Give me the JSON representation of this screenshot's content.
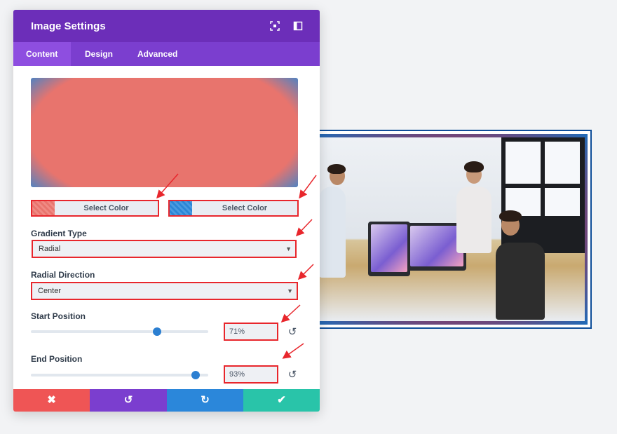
{
  "modal": {
    "title": "Image Settings",
    "header_icons": [
      "focus-icon",
      "sidebar-layout-icon"
    ]
  },
  "tabs": [
    {
      "label": "Content",
      "active": true
    },
    {
      "label": "Design",
      "active": false
    },
    {
      "label": "Advanced",
      "active": false
    }
  ],
  "gradient": {
    "color1": "#e8746d",
    "color2": "#2b86d6",
    "select_color_1": "Select Color",
    "select_color_2": "Select Color",
    "gradient_type_label": "Gradient Type",
    "gradient_type_value": "Radial",
    "radial_direction_label": "Radial Direction",
    "radial_direction_value": "Center",
    "start_position_label": "Start Position",
    "start_position_value": "71%",
    "start_position_fraction": 0.71,
    "end_position_label": "End Position",
    "end_position_value": "93%",
    "end_position_fraction": 0.93
  },
  "footer": {
    "buttons": [
      {
        "name": "cancel",
        "icon": "close-icon",
        "glyph": "✖",
        "color": "#ef5555"
      },
      {
        "name": "undo",
        "icon": "undo-icon",
        "glyph": "↺",
        "color": "#7b3ecf"
      },
      {
        "name": "redo",
        "icon": "redo-icon",
        "glyph": "↻",
        "color": "#2b87da"
      },
      {
        "name": "save",
        "icon": "check-icon",
        "glyph": "✔",
        "color": "#29c4a9"
      }
    ]
  },
  "colors": {
    "header": "#6c2eb9",
    "tabs": "#7b3ecf",
    "highlight": "#e8262c"
  }
}
